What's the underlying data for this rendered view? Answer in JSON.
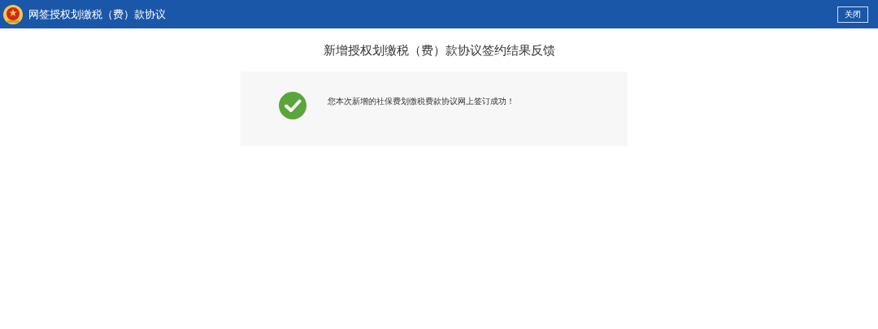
{
  "header": {
    "title": "网签授权划缴税（费）款协议",
    "close_button": "关闭"
  },
  "page_title": "新增授权划缴税（费）款协议签约结果反馈",
  "result": {
    "succeeded": true,
    "message": "您本次新增的社保费划缴税费款协议网上签订成功！"
  }
}
